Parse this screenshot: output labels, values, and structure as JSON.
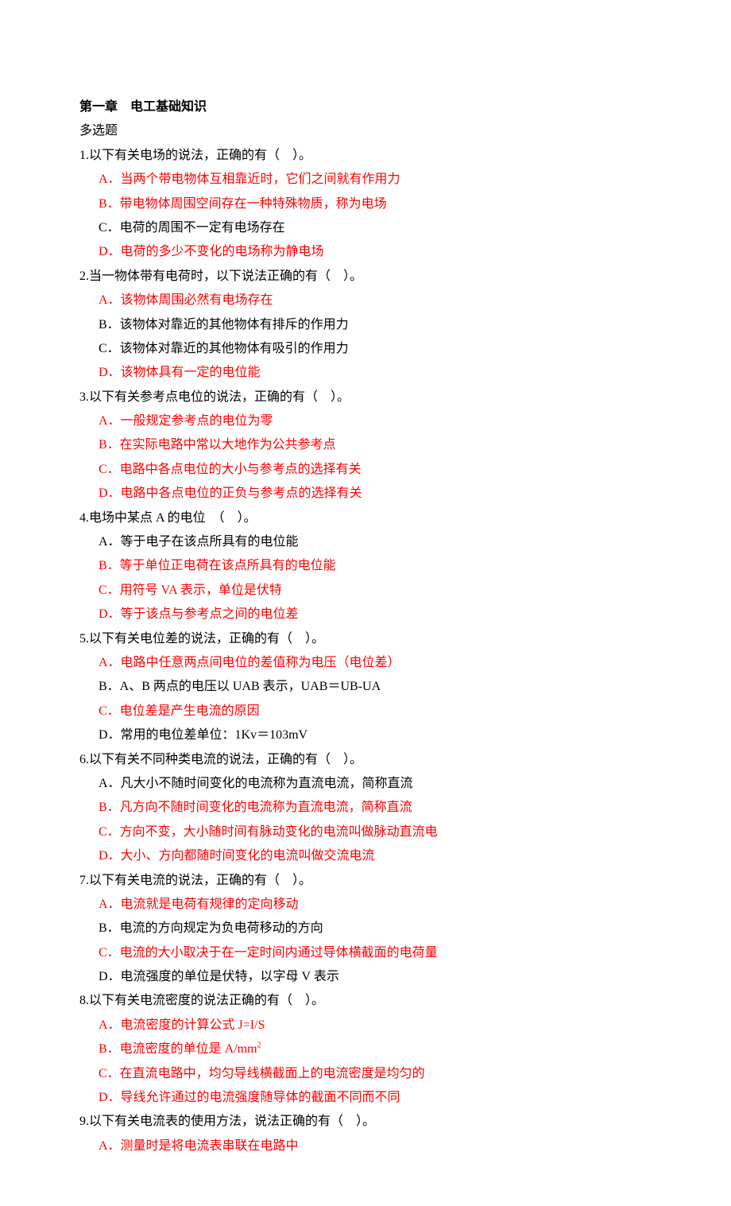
{
  "chapter_title": "第一章　电工基础知识",
  "section_label": "多选题",
  "questions": [
    {
      "number": "1",
      "text": "以下有关电场的说法，正确的有（　）。",
      "options": [
        {
          "letter": "A",
          "text": "当两个带电物体互相靠近时，它们之间就有作用力",
          "correct": true
        },
        {
          "letter": "B",
          "text": "带电物体周围空间存在一种特殊物质，称为电场",
          "correct": true
        },
        {
          "letter": "C",
          "text": "电荷的周围不一定有电场存在",
          "correct": false
        },
        {
          "letter": "D",
          "text": "电荷的多少不变化的电场称为静电场",
          "correct": true
        }
      ]
    },
    {
      "number": "2",
      "text": "当一物体带有电荷时，以下说法正确的有（　）。",
      "options": [
        {
          "letter": "A",
          "text": "该物体周围必然有电场存在",
          "correct": true
        },
        {
          "letter": "B",
          "text": "该物体对靠近的其他物体有排斥的作用力",
          "correct": false
        },
        {
          "letter": "C",
          "text": "该物体对靠近的其他物体有吸引的作用力",
          "correct": false
        },
        {
          "letter": "D",
          "text": "该物体具有一定的电位能",
          "correct": true
        }
      ]
    },
    {
      "number": "3",
      "text": "以下有关参考点电位的说法，正确的有（　）。",
      "options": [
        {
          "letter": "A",
          "text": "一般规定参考点的电位为零",
          "correct": true
        },
        {
          "letter": "B",
          "text": "在实际电路中常以大地作为公共参考点",
          "correct": true
        },
        {
          "letter": "C",
          "text": "电路中各点电位的大小与参考点的选择有关",
          "correct": true
        },
        {
          "letter": "D",
          "text": "电路中各点电位的正负与参考点的选择有关",
          "correct": true
        }
      ]
    },
    {
      "number": "4",
      "text": "电场中某点 A 的电位　（　）。",
      "options": [
        {
          "letter": "A",
          "text": "等于电子在该点所具有的电位能",
          "correct": false
        },
        {
          "letter": "B",
          "text": "等于单位正电荷在该点所具有的电位能",
          "correct": true
        },
        {
          "letter": "C",
          "text": "用符号 VA 表示，单位是伏特",
          "correct": true
        },
        {
          "letter": "D",
          "text": "等于该点与参考点之间的电位差",
          "correct": true
        }
      ]
    },
    {
      "number": "5",
      "text": "以下有关电位差的说法，正确的有（　）。",
      "options": [
        {
          "letter": "A",
          "text": "电路中任意两点间电位的差值称为电压（电位差）",
          "correct": true
        },
        {
          "letter": "B",
          "text": "A、B 两点的电压以 UAB 表示，UAB＝UB-UA",
          "correct": false
        },
        {
          "letter": "C",
          "text": "电位差是产生电流的原因",
          "correct": true
        },
        {
          "letter": "D",
          "text": "常用的电位差单位：1Kv＝103mV",
          "correct": false
        }
      ]
    },
    {
      "number": "6",
      "text": "以下有关不同种类电流的说法，正确的有（　）。",
      "options": [
        {
          "letter": "A",
          "text": "凡大小不随时间变化的电流称为直流电流，简称直流",
          "correct": false
        },
        {
          "letter": "B",
          "text": "凡方向不随时间变化的电流称为直流电流，简称直流",
          "correct": true
        },
        {
          "letter": "C",
          "text": "方向不变，大小随时间有脉动变化的电流叫做脉动直流电",
          "correct": true
        },
        {
          "letter": "D",
          "text": "大小、方向都随时间变化的电流叫做交流电流",
          "correct": true
        }
      ]
    },
    {
      "number": "7",
      "text": "以下有关电流的说法，正确的有（　）。",
      "options": [
        {
          "letter": "A",
          "text": "电流就是电荷有规律的定向移动",
          "correct": true
        },
        {
          "letter": "B",
          "text": "电流的方向规定为负电荷移动的方向",
          "correct": false
        },
        {
          "letter": "C",
          "text": "电流的大小取决于在一定时间内通过导体横截面的电荷量",
          "correct": true
        },
        {
          "letter": "D",
          "text": "电流强度的单位是伏特，以字母 V 表示",
          "correct": false
        }
      ]
    },
    {
      "number": "8",
      "text": "以下有关电流密度的说法正确的有（　）。",
      "options": [
        {
          "letter": "A",
          "text": "电流密度的计算公式 J=I/S",
          "correct": true
        },
        {
          "letter": "B",
          "text": "电流密度的单位是 A/mm",
          "sup": "2",
          "correct": true
        },
        {
          "letter": "C",
          "text": "在直流电路中，均匀导线横截面上的电流密度是均匀的",
          "correct": true
        },
        {
          "letter": "D",
          "text": "导线允许通过的电流强度随导体的截面不同而不同",
          "correct": true
        }
      ]
    },
    {
      "number": "9",
      "text": "以下有关电流表的使用方法，说法正确的有（　）。",
      "options": [
        {
          "letter": "A",
          "text": "测量时是将电流表串联在电路中",
          "correct": true
        }
      ]
    }
  ]
}
